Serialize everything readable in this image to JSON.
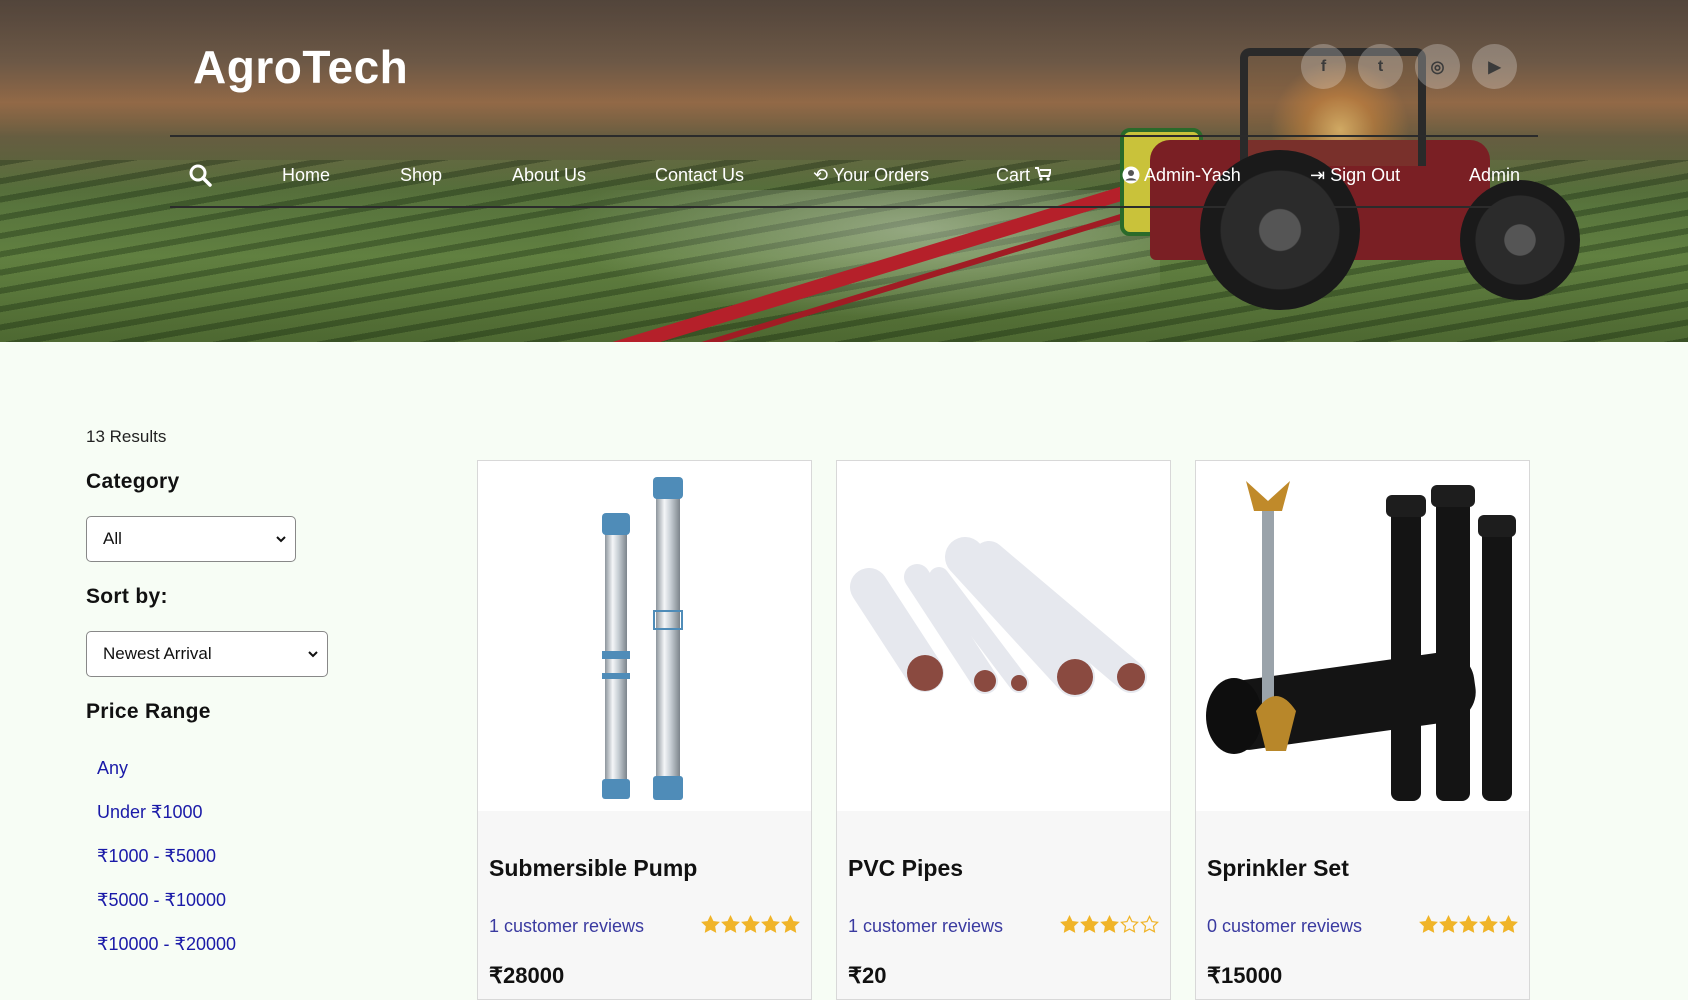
{
  "header": {
    "brand": "AgroTech",
    "social_icons": [
      "facebook-icon",
      "twitter-icon",
      "instagram-icon",
      "youtube-icon"
    ],
    "social_glyphs": [
      "f",
      "t",
      "◎",
      "▶"
    ]
  },
  "nav": {
    "items": [
      "Home",
      "Shop",
      "About Us",
      "Contact Us",
      "Your Orders",
      "Cart",
      "Admin-Yash",
      "Sign Out",
      "Admin"
    ]
  },
  "filters": {
    "results_text": "13 Results",
    "category_label": "Category",
    "category_value": "All",
    "sort_label": "Sort by:",
    "sort_value": "Newest Arrival",
    "price_label": "Price Range",
    "price_options": [
      "Any",
      "Under ₹1000",
      "₹1000 - ₹5000",
      "₹5000 - ₹10000",
      "₹10000 - ₹20000"
    ]
  },
  "products": [
    {
      "name": "Submersible Pump",
      "reviews": "1 customer reviews",
      "rating": 5,
      "price": "₹28000"
    },
    {
      "name": "PVC Pipes",
      "reviews": "1 customer reviews",
      "rating": 3,
      "price": "₹20"
    },
    {
      "name": "Sprinkler Set",
      "reviews": "0 customer reviews",
      "rating": 5,
      "price": "₹15000"
    }
  ],
  "colors": {
    "star": "#f0b429",
    "link": "#1a1aa8",
    "page_bg": "#f7fdf5"
  }
}
